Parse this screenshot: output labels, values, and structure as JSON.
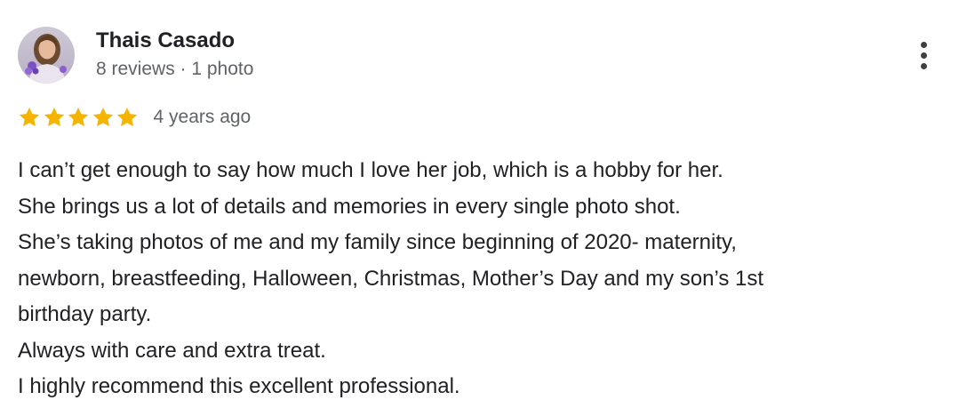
{
  "reviewer": {
    "name": "Thais Casado",
    "meta": "8 reviews · 1 photo",
    "avatar_icon": "profile-photo"
  },
  "menu": {
    "icon": "more-vert-icon"
  },
  "rating": {
    "stars": 5,
    "max_stars": 5,
    "star_color": "#f4b400",
    "date": "4 years ago"
  },
  "review": {
    "lines": [
      "I can’t get enough to say how much I love her job, which is a hobby for her.",
      "She brings us a lot of details and memories in every single photo shot.",
      "She’s taking photos of me and my family since beginning of 2020- maternity,",
      "newborn, breastfeeding, Halloween, Christmas, Mother’s Day and my son’s 1st",
      "birthday party.",
      "Always with care and extra treat.",
      "I highly recommend this excellent professional."
    ]
  }
}
